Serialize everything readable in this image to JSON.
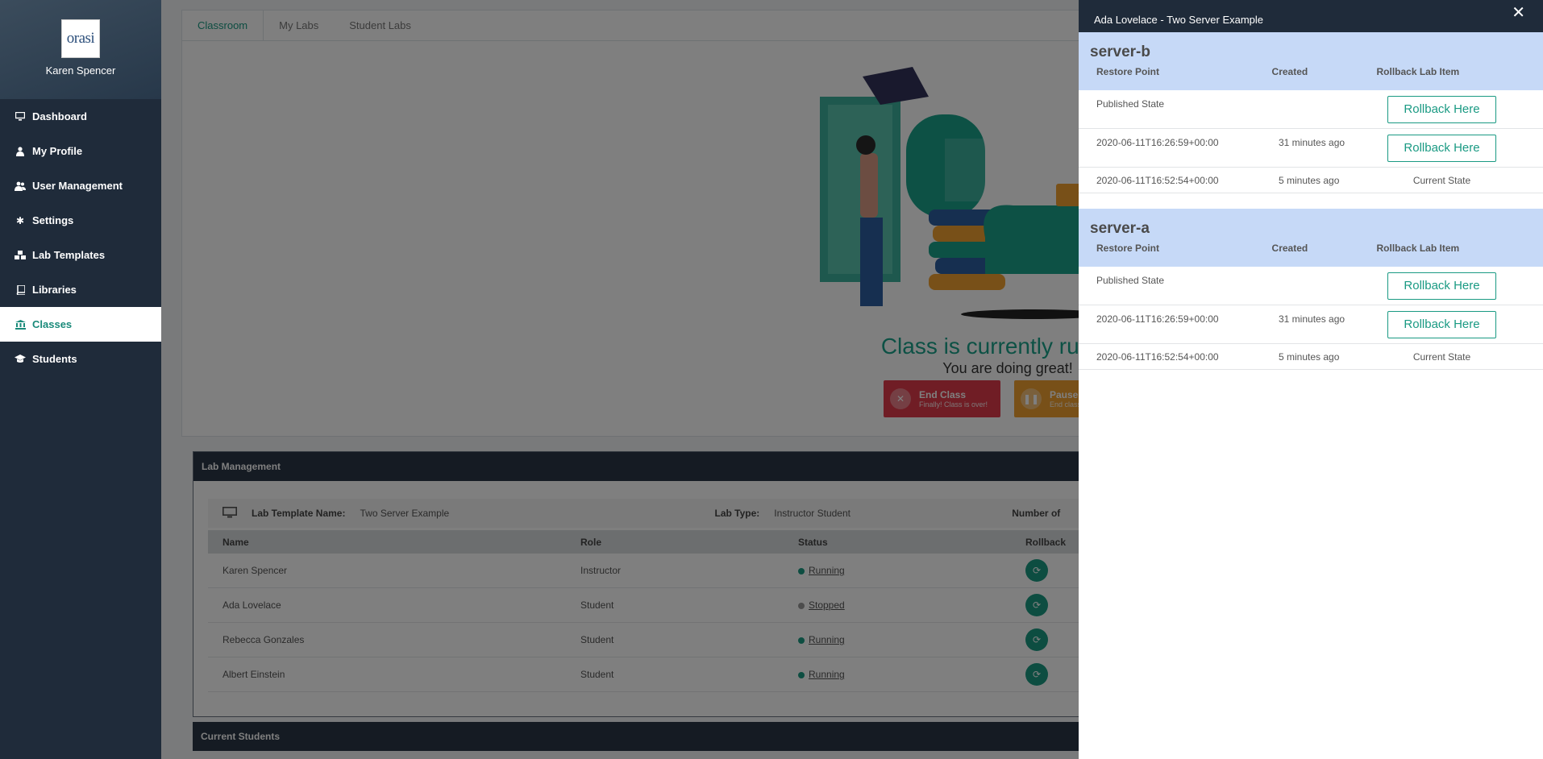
{
  "sidebar": {
    "logo_text": "orasi",
    "user_name": "Karen Spencer",
    "items": [
      {
        "label": "Dashboard",
        "icon": "monitor-icon"
      },
      {
        "label": "My Profile",
        "icon": "user-icon"
      },
      {
        "label": "User Management",
        "icon": "users-icon"
      },
      {
        "label": "Settings",
        "icon": "gear-icon"
      },
      {
        "label": "Lab Templates",
        "icon": "cubes-icon"
      },
      {
        "label": "Libraries",
        "icon": "book-icon"
      },
      {
        "label": "Classes",
        "icon": "bank-icon",
        "active": true
      },
      {
        "label": "Students",
        "icon": "graduation-cap-icon"
      }
    ]
  },
  "main": {
    "tabs": [
      {
        "label": "Classroom",
        "active": true
      },
      {
        "label": "My Labs"
      },
      {
        "label": "Student Labs"
      }
    ],
    "status_title": "Class is currently running",
    "status_subtitle": "You are doing great!",
    "end_class": {
      "title": "End Class",
      "subtitle": "Finally! Class is over!"
    },
    "pause_class": {
      "title": "Pause Class",
      "subtitle": "End class for today"
    },
    "lab_management": {
      "header": "Lab Management",
      "template_label": "Lab Template Name:",
      "template_value": "Two Server Example",
      "type_label": "Lab Type:",
      "type_value": "Instructor Student",
      "number_label": "Number of",
      "columns": {
        "name": "Name",
        "role": "Role",
        "status": "Status",
        "rollback": "Rollback"
      },
      "rows": [
        {
          "name": "Karen Spencer",
          "role": "Instructor",
          "status": "Running"
        },
        {
          "name": "Ada Lovelace",
          "role": "Student",
          "status": "Stopped"
        },
        {
          "name": "Rebecca Gonzales",
          "role": "Student",
          "status": "Running"
        },
        {
          "name": "Albert Einstein",
          "role": "Student",
          "status": "Running"
        }
      ]
    },
    "current_students_header": "Current Students"
  },
  "panel": {
    "title": "Ada Lovelace - Two Server Example",
    "close_symbol": "✕",
    "col_restore": "Restore Point",
    "col_created": "Created",
    "col_rollback": "Rollback Lab Item",
    "servers": [
      {
        "name": "server-b",
        "rows": [
          {
            "restore": "Published State",
            "created": "",
            "action": "Rollback Here"
          },
          {
            "restore": "2020-06-11T16:26:59+00:00",
            "created": "31 minutes ago",
            "action": "Rollback Here"
          },
          {
            "restore": "2020-06-11T16:52:54+00:00",
            "created": "5 minutes ago",
            "current": "Current State"
          }
        ]
      },
      {
        "name": "server-a",
        "rows": [
          {
            "restore": "Published State",
            "created": "",
            "action": "Rollback Here"
          },
          {
            "restore": "2020-06-11T16:26:59+00:00",
            "created": "31 minutes ago",
            "action": "Rollback Here"
          },
          {
            "restore": "2020-06-11T16:52:54+00:00",
            "created": "5 minutes ago",
            "current": "Current State"
          }
        ]
      }
    ]
  }
}
